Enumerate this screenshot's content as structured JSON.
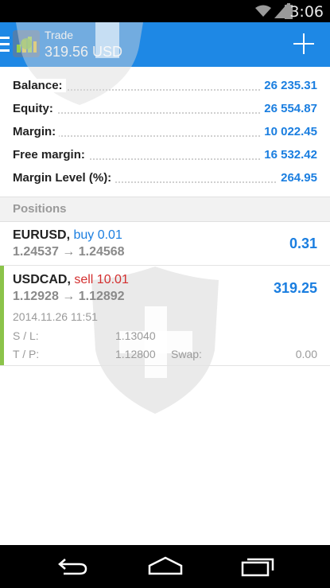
{
  "status_bar": {
    "time": "3:06"
  },
  "app_bar": {
    "title": "Trade",
    "subtitle": "319.56 USD"
  },
  "summary": [
    {
      "label": "Balance:",
      "value": "26 235.31"
    },
    {
      "label": "Equity:",
      "value": "26 554.87"
    },
    {
      "label": "Margin:",
      "value": "10 022.45"
    },
    {
      "label": "Free margin:",
      "value": "16 532.42"
    },
    {
      "label": "Margin Level (%):",
      "value": "264.95"
    }
  ],
  "positions_header": "Positions",
  "positions": [
    {
      "symbol": "EURUSD,",
      "type": "buy 0.01",
      "type_color": "#1a7ee0",
      "prices": "1.24537 → 1.24568",
      "profit": "0.31"
    },
    {
      "symbol": "USDCAD,",
      "type": "sell 10.01",
      "type_color": "#d32f2f",
      "prices": "1.12928 → 1.12892",
      "profit": "319.25",
      "open_time": "2014.11.26 11:51",
      "sl_label": "S / L:",
      "sl_value": "1.13040",
      "tp_label": "T / P:",
      "tp_value": "1.12800",
      "swap_label": "Swap:",
      "swap_value": "0.00"
    }
  ],
  "colors": {
    "app_bar": "#1e88e5",
    "value_blue": "#1a7ee0",
    "sell_red": "#d32f2f",
    "accent_green": "#8bc34a"
  }
}
